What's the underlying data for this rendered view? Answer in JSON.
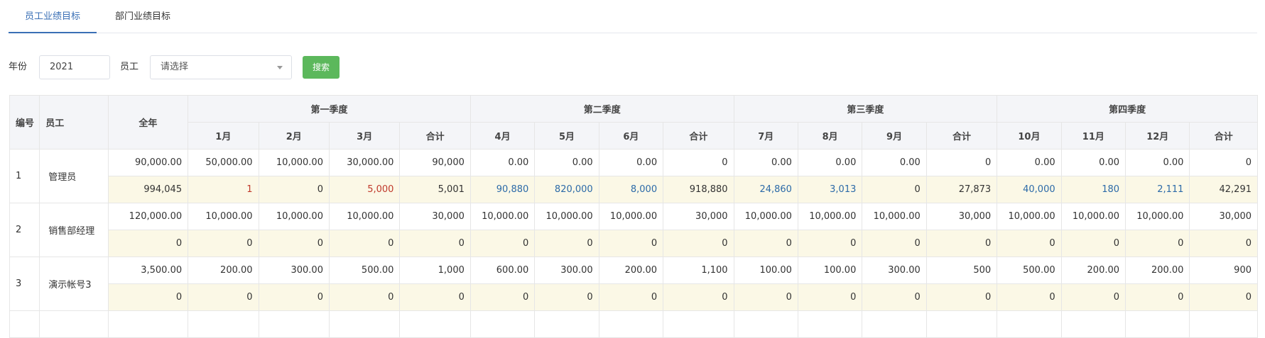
{
  "tabs": [
    {
      "label": "员工业绩目标",
      "active": true
    },
    {
      "label": "部门业绩目标",
      "active": false
    }
  ],
  "filter": {
    "year_label": "年份",
    "year_value": "2021",
    "employee_label": "员工",
    "employee_placeholder": "请选择",
    "search_label": "搜索"
  },
  "colors": {
    "accent": "#3a6fb5",
    "search_button": "#5cb85c",
    "actual_row_bg": "#fbf8e6",
    "red_value": "#c0392b",
    "blue_value": "#2c6aa8"
  },
  "table": {
    "headers": {
      "no": "编号",
      "employee": "员工",
      "full_year": "全年",
      "quarters": [
        "第一季度",
        "第二季度",
        "第三季度",
        "第四季度"
      ],
      "months": [
        "1月",
        "2月",
        "3月",
        "合计",
        "4月",
        "5月",
        "6月",
        "合计",
        "7月",
        "8月",
        "9月",
        "合计",
        "10月",
        "11月",
        "12月",
        "合计"
      ]
    },
    "rows": [
      {
        "no": "1",
        "name": "管理员",
        "target": [
          "90,000.00",
          "50,000.00",
          "10,000.00",
          "30,000.00",
          "90,000",
          "0.00",
          "0.00",
          "0.00",
          "0",
          "0.00",
          "0.00",
          "0.00",
          "0",
          "0.00",
          "0.00",
          "0.00",
          "0"
        ],
        "actual": [
          "994,045",
          "1",
          "0",
          "5,000",
          "5,001",
          "90,880",
          "820,000",
          "8,000",
          "918,880",
          "24,860",
          "3,013",
          "0",
          "27,873",
          "40,000",
          "180",
          "2,111",
          "42,291"
        ],
        "actual_colors": [
          "",
          "red",
          "",
          "red",
          "",
          "blue",
          "blue",
          "blue",
          "",
          "blue",
          "blue",
          "",
          "",
          "blue",
          "blue",
          "blue",
          ""
        ]
      },
      {
        "no": "2",
        "name": "销售部经理",
        "target": [
          "120,000.00",
          "10,000.00",
          "10,000.00",
          "10,000.00",
          "30,000",
          "10,000.00",
          "10,000.00",
          "10,000.00",
          "30,000",
          "10,000.00",
          "10,000.00",
          "10,000.00",
          "30,000",
          "10,000.00",
          "10,000.00",
          "10,000.00",
          "30,000"
        ],
        "actual": [
          "0",
          "0",
          "0",
          "0",
          "0",
          "0",
          "0",
          "0",
          "0",
          "0",
          "0",
          "0",
          "0",
          "0",
          "0",
          "0",
          "0"
        ],
        "actual_colors": [
          "",
          "",
          "",
          "",
          "",
          "",
          "",
          "",
          "",
          "",
          "",
          "",
          "",
          "",
          "",
          "",
          ""
        ]
      },
      {
        "no": "3",
        "name": "演示帐号3",
        "target": [
          "3,500.00",
          "200.00",
          "300.00",
          "500.00",
          "1,000",
          "600.00",
          "300.00",
          "200.00",
          "1,100",
          "100.00",
          "100.00",
          "300.00",
          "500",
          "500.00",
          "200.00",
          "200.00",
          "900"
        ],
        "actual": [
          "0",
          "0",
          "0",
          "0",
          "0",
          "0",
          "0",
          "0",
          "0",
          "0",
          "0",
          "0",
          "0",
          "0",
          "0",
          "0",
          "0"
        ],
        "actual_colors": [
          "",
          "",
          "",
          "",
          "",
          "",
          "",
          "",
          "",
          "",
          "",
          "",
          "",
          "",
          "",
          "",
          ""
        ]
      }
    ]
  }
}
